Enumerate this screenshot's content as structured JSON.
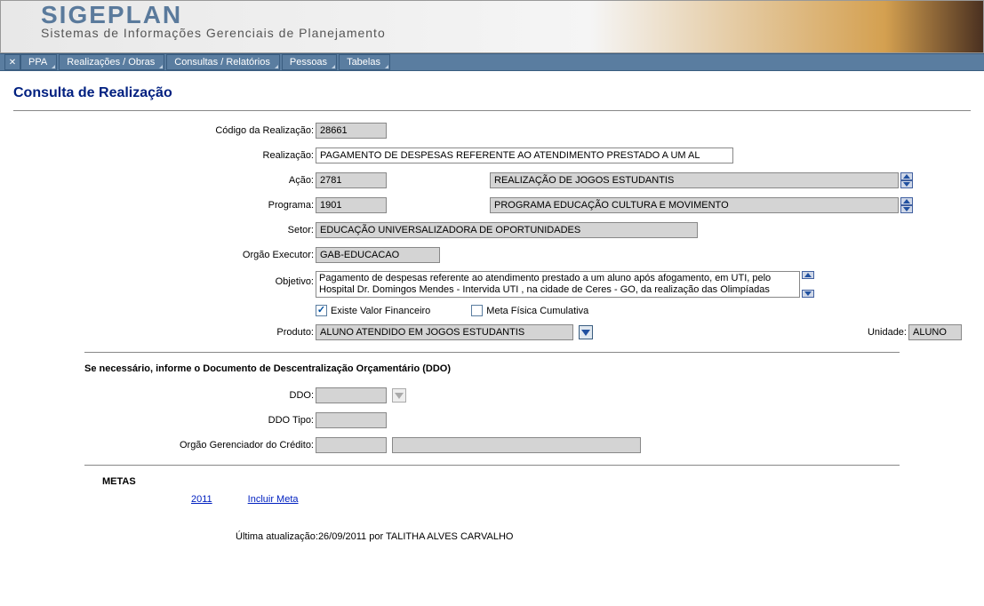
{
  "header": {
    "logo": "SIGEPLAN",
    "subtitle": "Sistemas de Informações Gerenciais de Planejamento"
  },
  "menu": {
    "items": [
      "PPA",
      "Realizações / Obras",
      "Consultas / Relatórios",
      "Pessoas",
      "Tabelas"
    ]
  },
  "page": {
    "title": "Consulta de Realização"
  },
  "form": {
    "codigo_label": "Código da Realização:",
    "codigo_value": "28661",
    "realizacao_label": "Realização:",
    "realizacao_value": "PAGAMENTO DE DESPESAS REFERENTE AO ATENDIMENTO PRESTADO A UM AL",
    "acao_label": "Ação:",
    "acao_code": "2781",
    "acao_desc": "REALIZAÇÃO DE JOGOS ESTUDANTIS",
    "programa_label": "Programa:",
    "programa_code": "1901",
    "programa_desc": "PROGRAMA EDUCAÇÃO CULTURA E MOVIMENTO",
    "setor_label": "Setor:",
    "setor_value": "EDUCAÇÃO UNIVERSALIZADORA DE OPORTUNIDADES",
    "orgao_exec_label": "Orgão Executor:",
    "orgao_exec_value": "GAB-EDUCACAO",
    "objetivo_label": "Objetivo:",
    "objetivo_value": "Pagamento de despesas referente ao atendimento prestado a um aluno após afogamento, em UTI, pelo Hospital Dr. Domingos Mendes - Intervida UTI , na cidade de Ceres - GO, da realização das Olimpíadas",
    "cb_valor_label": "Existe Valor Financeiro",
    "cb_meta_label": "Meta Física Cumulativa",
    "produto_label": "Produto:",
    "produto_value": "ALUNO ATENDIDO EM JOGOS ESTUDANTIS",
    "unidade_label": "Unidade:",
    "unidade_value": "ALUNO"
  },
  "ddo": {
    "note": "Se necessário, informe o Documento de Descentralização Orçamentário (DDO)",
    "ddo_label": "DDO:",
    "ddo_value": "",
    "ddo_tipo_label": "DDO Tipo:",
    "ddo_tipo_value": "",
    "orgao_cred_label": "Orgão Gerenciador do Crédito:",
    "orgao_cred_code": "",
    "orgao_cred_desc": ""
  },
  "metas": {
    "title": "METAS",
    "year_link": "2011",
    "incluir_link": "Incluir Meta"
  },
  "footer": {
    "update_label": "Última atualização:",
    "update_value": "26/09/2011 por TALITHA ALVES CARVALHO"
  }
}
